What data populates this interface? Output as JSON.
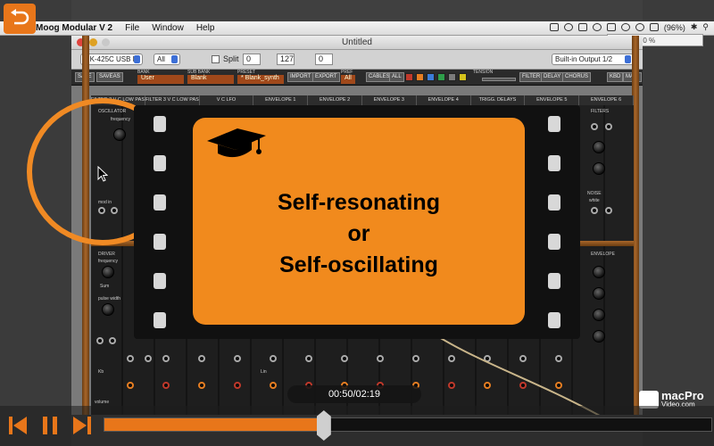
{
  "menubar": {
    "app_name": "Moog Modular V 2",
    "items": [
      "File",
      "Window",
      "Help"
    ],
    "battery": "(96%)",
    "cpu_label": "Cpu : 0 %"
  },
  "window": {
    "title": "Untitled"
  },
  "toolbar": {
    "midi_device": "MK-425C USB M",
    "midi_channel": "All",
    "split_label": "Split",
    "split_low": "0",
    "split_high": "127",
    "split_value": "0",
    "output": "Built-in Output 1/2"
  },
  "preset_bar": {
    "save_label": "SAVE",
    "save_as_label": "SAVEAS",
    "bank_caption": "BANK",
    "bank_value": "User",
    "sub_bank_caption": "SUB BANK",
    "sub_bank_value": "Blank",
    "preset_caption": "PRESET",
    "preset_value": "* Blank_synth",
    "import_label": "IMPORT",
    "export_label": "EXPORT",
    "prefs_caption": "PREF",
    "prefs_value": "All",
    "cables_label": "CABLES",
    "cables_all": "ALL",
    "tension_label": "TENSION",
    "filter_label": "FILTER",
    "delay_label": "DELAY",
    "chorus_label": "CHORUS",
    "kbd_label": "KBD",
    "main_label": "MAIN",
    "colors": [
      "#c0392b",
      "#e67e22",
      "#3b7dd8",
      "#2e9e4a",
      "#7b7b7b",
      "#d4c21c"
    ]
  },
  "module_tabs": [
    "FILTER 2 V C LOW PASS",
    "FILTER 3 V C LOW PASS",
    "V C LFO",
    "ENVELOPE 1",
    "ENVELOPE 2",
    "ENVELOPE 3",
    "ENVELOPE 4",
    "TRIGG. DELAYS",
    "ENVELOPE 5",
    "ENVELOPE 6"
  ],
  "panel_labels": {
    "oscillator": "OSCILLATOR",
    "frequency": "frequency",
    "filters": "FILTERS",
    "noise": "NOISE",
    "white": "white",
    "driver": "DRIVER",
    "envelope": "ENVELOPE",
    "mod_in": "mod in",
    "pulse_width": "pulse width",
    "sum": "Sum",
    "lin": "Lin",
    "kb": "Kb",
    "volume": "volume"
  },
  "overlay": {
    "line1": "Self-resonating",
    "line2": "or",
    "line3": "Self-oscillating"
  },
  "player": {
    "time": "00:50/02:19",
    "progress": 0.363,
    "brand_name": "macPro",
    "brand_domain": "Video.com"
  }
}
